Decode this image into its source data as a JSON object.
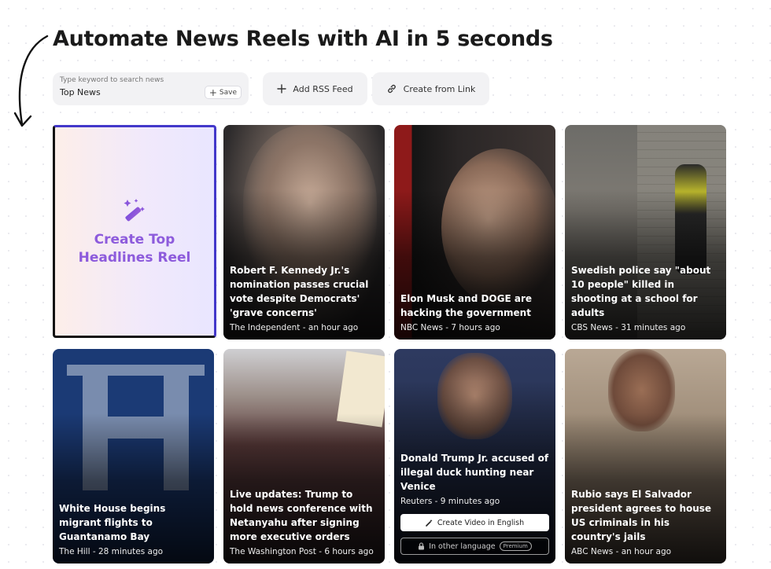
{
  "header": {
    "title": "Automate News Reels with AI in 5 seconds"
  },
  "search": {
    "label": "Type keyword to search news",
    "value": "Top News",
    "save_label": "Save"
  },
  "actions": {
    "rss_label": "Add RSS Feed",
    "link_label": "Create from Link"
  },
  "create_card": {
    "line1": "Create Top",
    "line2": "Headlines Reel"
  },
  "cards": [
    {
      "title": "Robert F. Kennedy Jr.'s nomination passes crucial vote despite Democrats' 'grave concerns'",
      "meta": "The Independent - an hour ago"
    },
    {
      "title": "Elon Musk and DOGE are hacking the government",
      "meta": "NBC News - 7 hours ago"
    },
    {
      "title": "Swedish police say \"about 10 people\" killed in shooting at a school for adults",
      "meta": "CBS News - 31 minutes ago"
    },
    {
      "title": "White House begins migrant flights to Guantanamo Bay",
      "meta": "The Hill - 28 minutes ago"
    },
    {
      "title": "Live updates: Trump to hold news conference with Netanyahu after signing more executive orders",
      "meta": "The Washington Post - 6 hours ago"
    },
    {
      "title": "Donald Trump Jr. accused of illegal duck hunting near Venice",
      "meta": "Reuters - 9 minutes ago",
      "create_video_label": "Create Video in English",
      "other_language_label": "In other language",
      "premium_label": "Premium"
    },
    {
      "title": "Rubio says El Salvador president agrees to house US criminals in his country's jails",
      "meta": "ABC News - an hour ago"
    }
  ]
}
